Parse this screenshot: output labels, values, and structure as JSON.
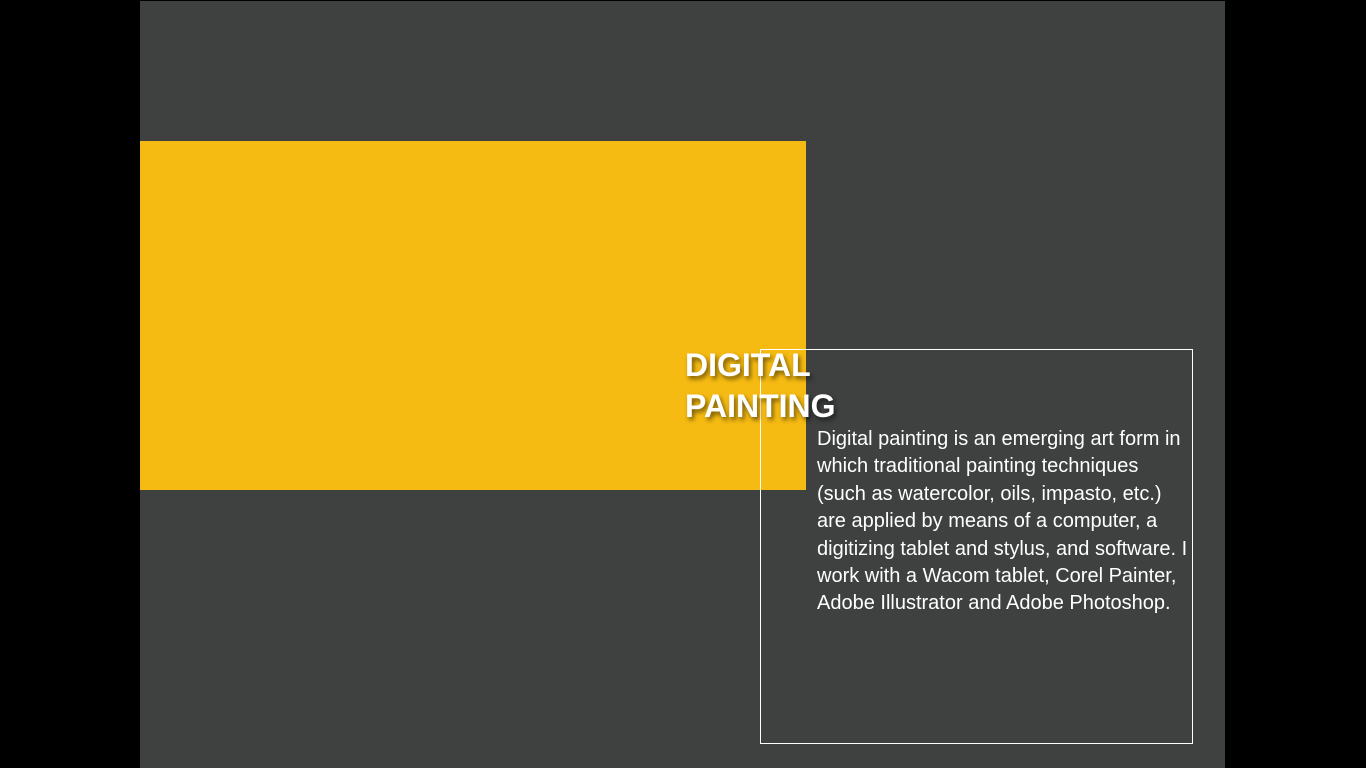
{
  "slide": {
    "title_line_1": "DIGITAL",
    "title_line_2": "PAINTING",
    "body": "Digital painting is an emerging art form in which traditional painting techniques (such as watercolor, oils, impasto, etc.) are applied by means of a computer, a digitizing tablet and stylus, and software. I work with a Wacom tablet, Corel Painter, Adobe Illustrator and Adobe Photoshop."
  },
  "colors": {
    "background": "#3f4040",
    "accent": "#f6bb12",
    "text": "#ffffff",
    "letterbox": "#000000"
  }
}
